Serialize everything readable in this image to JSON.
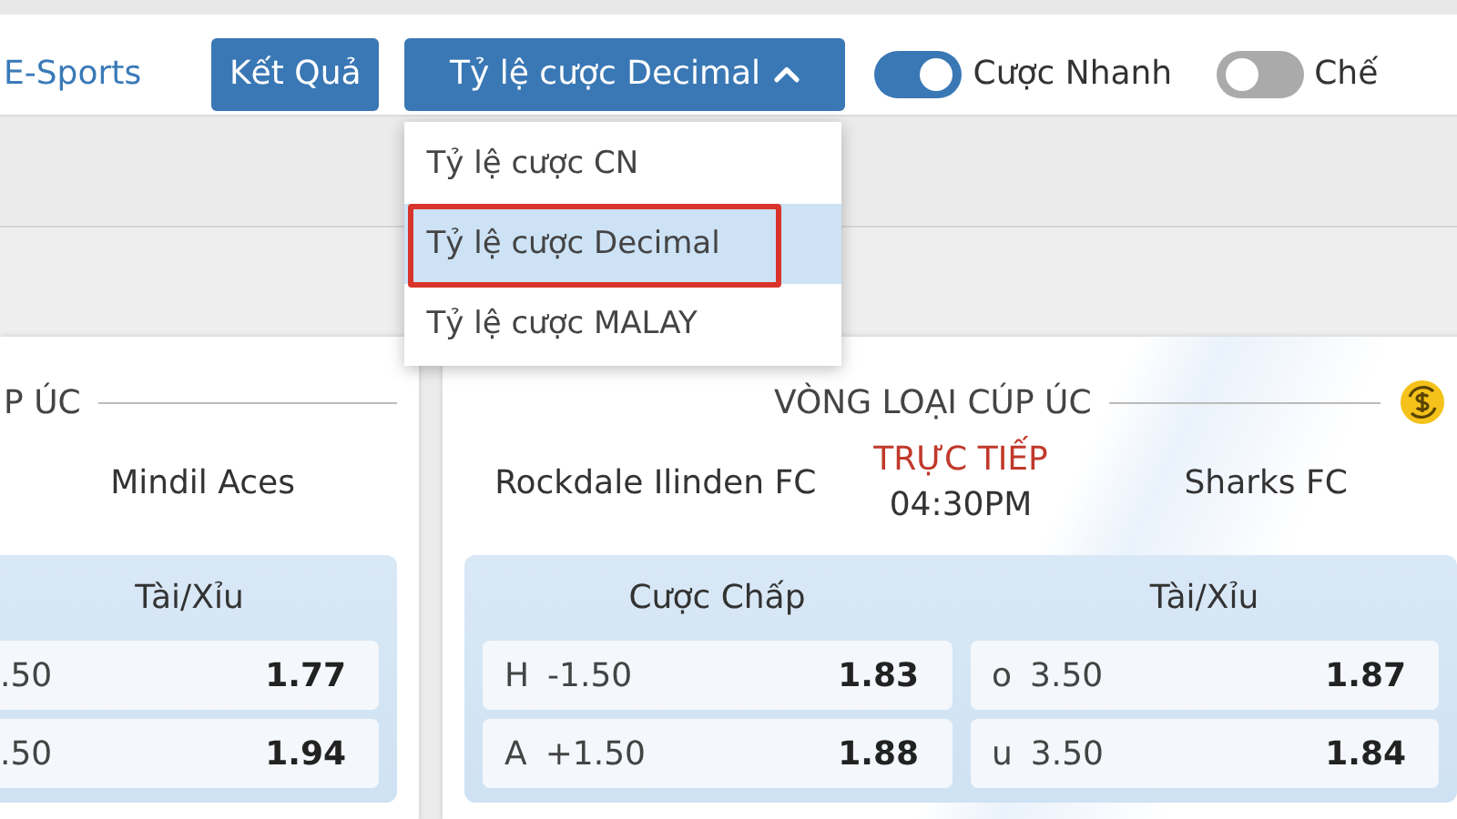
{
  "nav": {
    "link": "E-Sports",
    "results_button": "Kết Quả",
    "odds_dropdown": {
      "label": "Tỷ lệ cược Decimal",
      "expanded": true,
      "options": [
        {
          "label": "Tỷ lệ cược CN",
          "selected": false
        },
        {
          "label": "Tỷ lệ cược Decimal",
          "selected": true
        },
        {
          "label": "Tỷ lệ cược MALAY",
          "selected": false
        }
      ]
    },
    "toggles": [
      {
        "label": "Cược Nhanh",
        "on": true
      },
      {
        "label": "Chế",
        "on": false
      }
    ]
  },
  "matches": [
    {
      "league": "P ÚC",
      "away": "Mindil Aces",
      "markets": [
        {
          "title": "Tài/Xỉu",
          "rows": [
            {
              "line": ".50",
              "odds": "1.77"
            },
            {
              "line": ".50",
              "odds": "1.94"
            }
          ]
        }
      ]
    },
    {
      "league": "VÒNG LOẠI CÚP ÚC",
      "home": "Rockdale Ilinden FC",
      "status": "TRỰC TIẾP",
      "time": "04:30PM",
      "away": "Sharks FC",
      "markets": [
        {
          "title": "Cược Chấp",
          "rows": [
            {
              "side": "H",
              "line": "-1.50",
              "odds": "1.83"
            },
            {
              "side": "A",
              "line": "+1.50",
              "odds": "1.88"
            }
          ]
        },
        {
          "title": "Tài/Xỉu",
          "rows": [
            {
              "side": "o",
              "line": "3.50",
              "odds": "1.87"
            },
            {
              "side": "u",
              "line": "3.50",
              "odds": "1.84"
            }
          ]
        }
      ]
    }
  ]
}
